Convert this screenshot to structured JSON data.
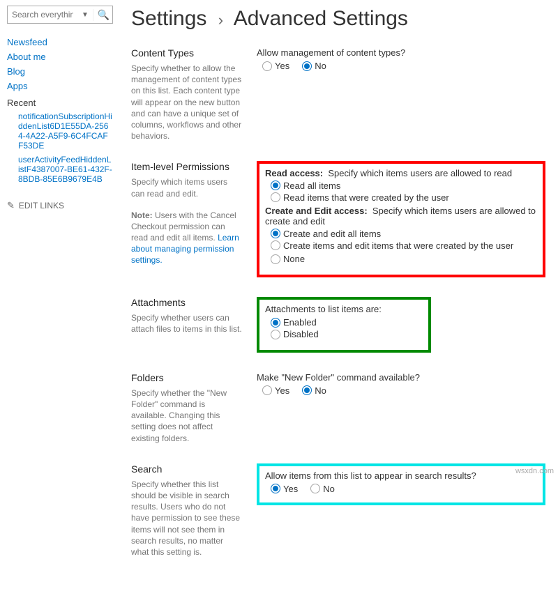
{
  "search": {
    "placeholder": "Search everything"
  },
  "nav": {
    "items": [
      {
        "label": "Newsfeed"
      },
      {
        "label": "About me"
      },
      {
        "label": "Blog"
      },
      {
        "label": "Apps"
      }
    ],
    "recent_hdr": "Recent",
    "recent": [
      {
        "label": "notificationSubscriptionHiddenList6D1E55DA-2564-4A22-A5F9-6C4FCAFF53DE"
      },
      {
        "label": "userActivityFeedHiddenListF4387007-BE61-432F-8BDB-85E6B9679E4B"
      }
    ],
    "edit_links": "EDIT LINKS"
  },
  "breadcrumb": {
    "root": "Settings",
    "leaf": "Advanced Settings"
  },
  "sections": {
    "content_types": {
      "title": "Content Types",
      "desc": "Specify whether to allow the management of content types on this list. Each content type will appear on the new button and can have a unique set of columns, workflows and other behaviors.",
      "q": "Allow management of content types?",
      "yes": "Yes",
      "no": "No"
    },
    "permissions": {
      "title": "Item-level Permissions",
      "desc1": "Specify which items users can read and edit.",
      "desc2a": "Note:",
      "desc2b": " Users with the Cancel Checkout permission can read and edit all items. ",
      "desc2c": "Learn about managing permission settings.",
      "read_hdr": "Read access:",
      "read_desc": "Specify which items users are allowed to read",
      "read_all": "Read all items",
      "read_own": "Read items that were created by the user",
      "edit_hdr": "Create and Edit access:",
      "edit_desc": "Specify which items users are allowed to create and edit",
      "edit_all": "Create and edit all items",
      "edit_own": "Create items and edit items that were created by the user",
      "none": "None"
    },
    "attachments": {
      "title": "Attachments",
      "desc": "Specify whether users can attach files to items in this list.",
      "q": "Attachments to list items are:",
      "enabled": "Enabled",
      "disabled": "Disabled"
    },
    "folders": {
      "title": "Folders",
      "desc": "Specify whether the \"New Folder\" command is available. Changing this setting does not affect existing folders.",
      "q": "Make \"New Folder\" command available?",
      "yes": "Yes",
      "no": "No"
    },
    "search": {
      "title": "Search",
      "desc": "Specify whether this list should be visible in search results. Users who do not have permission to see these items will not see them in search results, no matter what this setting is.",
      "q": "Allow items from this list to appear in search results?",
      "yes": "Yes",
      "no": "No"
    }
  },
  "watermark": "wsxdn.com"
}
